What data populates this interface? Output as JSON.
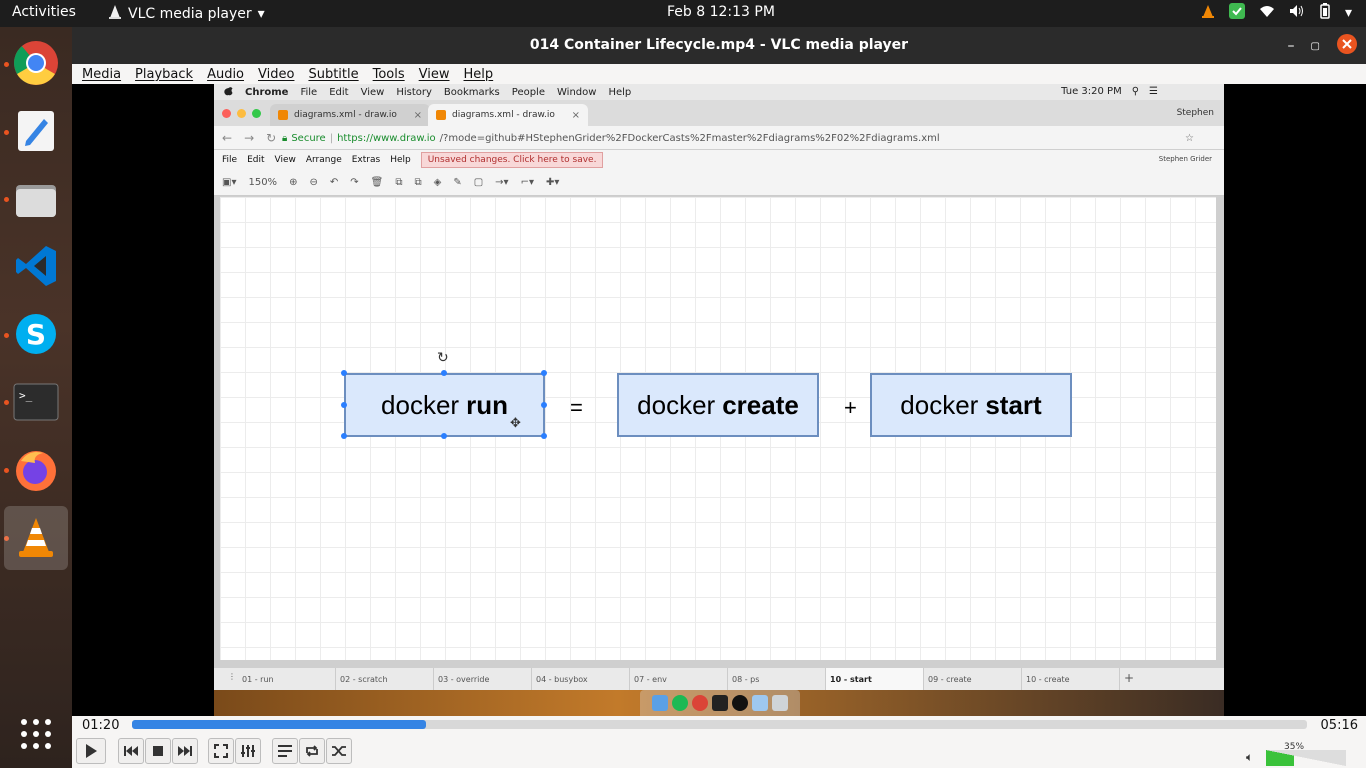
{
  "topbar": {
    "activities": "Activities",
    "app_name": "VLC media player",
    "clock": "Feb 8  12:13 PM"
  },
  "dock": {
    "apps": [
      "chrome-icon",
      "text-editor-icon",
      "files-icon",
      "vscode-icon",
      "skype-icon",
      "terminal-icon",
      "firefox-icon",
      "vlc-icon",
      "show-apps-icon"
    ]
  },
  "vlc": {
    "window_title": "014 Container Lifecycle.mp4 - VLC media player",
    "menu": [
      "Media",
      "Playback",
      "Audio",
      "Video",
      "Subtitle",
      "Tools",
      "View",
      "Help"
    ],
    "time_elapsed": "01:20",
    "time_total": "05:16",
    "progress": 0.25,
    "volume_label": "35%",
    "volume": 0.35
  },
  "mac": {
    "menubar": [
      "Chrome",
      "File",
      "Edit",
      "View",
      "History",
      "Bookmarks",
      "People",
      "Window",
      "Help"
    ],
    "clock": "Tue 3:20 PM",
    "user": "Stephen",
    "tabs": [
      {
        "label": "diagrams.xml - draw.io"
      },
      {
        "label": "diagrams.xml - draw.io"
      }
    ],
    "secure": "Secure",
    "url_host": "https://www.draw.io",
    "url_path": "/?mode=github#HStephenGrider%2FDockerCasts%2Fmaster%2Fdiagrams%2F02%2Fdiagrams.xml",
    "drawio_menu": [
      "File",
      "Edit",
      "View",
      "Arrange",
      "Extras",
      "Help"
    ],
    "unsaved": "Unsaved changes. Click here to save.",
    "drawio_user": "Stephen Grider",
    "zoom": "150%",
    "page_tabs": [
      "01 - run",
      "02 - scratch",
      "03 - override",
      "04 - busybox",
      "07 - env",
      "08 - ps",
      "10 - start",
      "09 - create",
      "10 - create"
    ],
    "active_page_index": 6
  },
  "diagram": {
    "box1_prefix": "docker",
    "box1_bold": "run",
    "equals": "=",
    "box2_prefix": "docker",
    "box2_bold": "create",
    "plus": "+",
    "box3_prefix": "docker",
    "box3_bold": "start"
  }
}
